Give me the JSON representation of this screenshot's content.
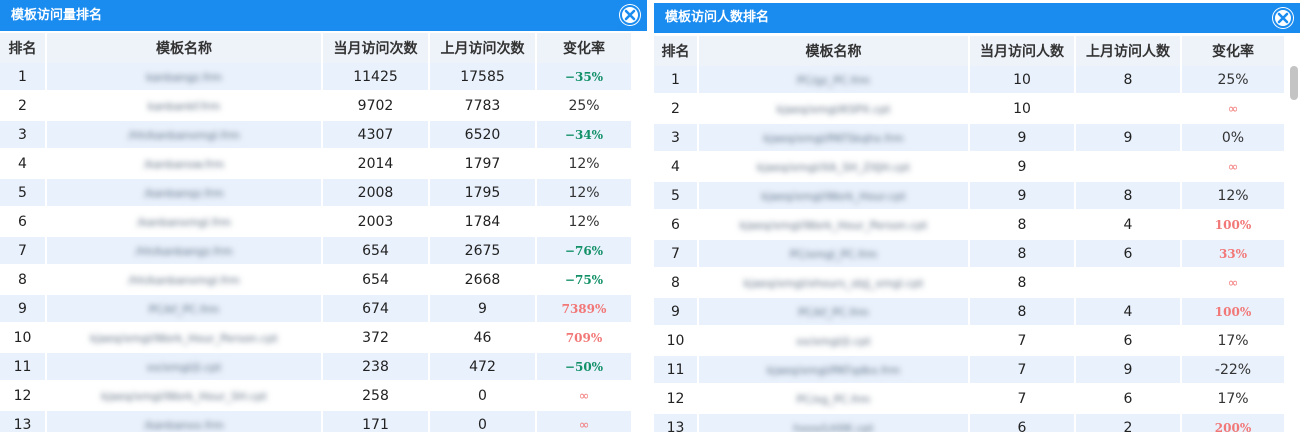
{
  "left_panel": {
    "title": "模板访问量排名",
    "headers": [
      "排名",
      "模板名称",
      "当月访问次数",
      "上月访问次数",
      "变化率"
    ],
    "rows": [
      {
        "rank": "1",
        "name": "kanbangz.frm",
        "cur": "11425",
        "prev": "17585",
        "rate": "−35%",
        "rate_type": "neg"
      },
      {
        "rank": "2",
        "name": "kanbankf.frm",
        "cur": "9702",
        "prev": "7783",
        "rate": "25%",
        "rate_type": "normal"
      },
      {
        "rank": "3",
        "name": "/hh/kanbanxmgl.frm",
        "cur": "4307",
        "prev": "6520",
        "rate": "−34%",
        "rate_type": "neg"
      },
      {
        "rank": "4",
        "name": "/kanbansw.frm",
        "cur": "2014",
        "prev": "1797",
        "rate": "12%",
        "rate_type": "normal"
      },
      {
        "rank": "5",
        "name": "/kanbanqz.frm",
        "cur": "2008",
        "prev": "1795",
        "rate": "12%",
        "rate_type": "normal"
      },
      {
        "rank": "6",
        "name": "/kanbanxmgl.frm",
        "cur": "2003",
        "prev": "1784",
        "rate": "12%",
        "rate_type": "normal"
      },
      {
        "rank": "7",
        "name": "/hh/kanbangz.frm",
        "cur": "654",
        "prev": "2675",
        "rate": "−76%",
        "rate_type": "neg"
      },
      {
        "rank": "8",
        "name": "/hh/kanbanxmgl.frm",
        "cur": "654",
        "prev": "2668",
        "rate": "−75%",
        "rate_type": "neg"
      },
      {
        "rank": "9",
        "name": "PC/kf_PC.frm",
        "cur": "674",
        "prev": "9",
        "rate": "7389%",
        "rate_type": "high"
      },
      {
        "rank": "10",
        "name": "kjaeq/xmgl/Work_Hour_Person.cpt",
        "cur": "372",
        "prev": "46",
        "rate": "709%",
        "rate_type": "high"
      },
      {
        "rank": "11",
        "name": "xx/xmgl/jl.cpt",
        "cur": "238",
        "prev": "472",
        "rate": "−50%",
        "rate_type": "neg"
      },
      {
        "rank": "12",
        "name": "kjaeq/xmgl/Work_Hour_SH.cpt",
        "cur": "258",
        "prev": "0",
        "rate": "∞",
        "rate_type": "inf"
      },
      {
        "rank": "13",
        "name": "/kanbanxx.frm",
        "cur": "171",
        "prev": "0",
        "rate": "∞",
        "rate_type": "inf"
      }
    ]
  },
  "right_panel": {
    "title": "模板访问人数排名",
    "headers": [
      "排名",
      "模板名称",
      "当月访问人数",
      "上月访问人数",
      "变化率"
    ],
    "rows": [
      {
        "rank": "1",
        "name": "PC/gz_PC.frm",
        "cur": "10",
        "prev": "8",
        "rate": "25%",
        "rate_type": "normal"
      },
      {
        "rank": "2",
        "name": "kjaeq/xmgl/KSPX.cpt",
        "cur": "10",
        "prev": "",
        "rate": "∞",
        "rate_type": "inf"
      },
      {
        "rank": "3",
        "name": "kjaeq/xmgl/PATSkqhx.frm",
        "cur": "9",
        "prev": "9",
        "rate": "0%",
        "rate_type": "normal"
      },
      {
        "rank": "4",
        "name": "kjaeq/xmgl/XA_SH_ZXJH.cpt",
        "cur": "9",
        "prev": "",
        "rate": "∞",
        "rate_type": "inf"
      },
      {
        "rank": "5",
        "name": "kjaeq/xmgl/Work_Hour.cpt",
        "cur": "9",
        "prev": "8",
        "rate": "12%",
        "rate_type": "normal"
      },
      {
        "rank": "6",
        "name": "kjaeq/xmgl/Work_Hour_Person.cpt",
        "cur": "8",
        "prev": "4",
        "rate": "100%",
        "rate_type": "high"
      },
      {
        "rank": "7",
        "name": "PC/xmgl_PC.frm",
        "cur": "8",
        "prev": "6",
        "rate": "33%",
        "rate_type": "high"
      },
      {
        "rank": "8",
        "name": "kjaeq/xmgl/xhours_sbjj_xmgl.cpt",
        "cur": "8",
        "prev": "",
        "rate": "∞",
        "rate_type": "inf"
      },
      {
        "rank": "9",
        "name": "PC/kf_PC.frm",
        "cur": "8",
        "prev": "4",
        "rate": "100%",
        "rate_type": "high"
      },
      {
        "rank": "10",
        "name": "xx/xmgl/jl.cpt",
        "cur": "7",
        "prev": "6",
        "rate": "17%",
        "rate_type": "normal"
      },
      {
        "rank": "11",
        "name": "kjaeq/xmgl/PATqdkx.frm",
        "cur": "7",
        "prev": "9",
        "rate": "-22%",
        "rate_type": "normal"
      },
      {
        "rank": "12",
        "name": "PC/xg_PC.frm",
        "cur": "7",
        "prev": "6",
        "rate": "17%",
        "rate_type": "normal"
      },
      {
        "rank": "13",
        "name": "hxxx/LHXK.cpt",
        "cur": "6",
        "prev": "2",
        "rate": "200%",
        "rate_type": "high"
      }
    ]
  },
  "icons": {
    "close": "close-circle-icon"
  },
  "colors": {
    "header": "#1a8cf0",
    "row_stripe": "#e9f1fc",
    "negative": "#129067",
    "positive_high": "#f27777"
  }
}
